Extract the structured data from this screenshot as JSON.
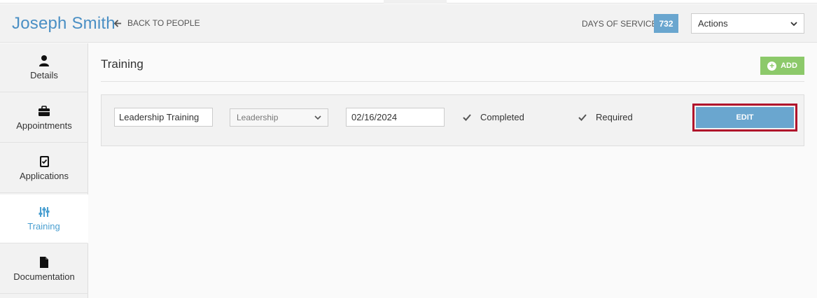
{
  "header": {
    "person_name": "Joseph Smith",
    "back_label": "BACK TO PEOPLE",
    "days_label": "DAYS OF SERVICE",
    "days_value": "732",
    "actions_label": "Actions"
  },
  "sidebar": {
    "items": [
      {
        "label": "Details",
        "icon": "user-icon"
      },
      {
        "label": "Appointments",
        "icon": "briefcase-icon"
      },
      {
        "label": "Applications",
        "icon": "clipboard-check-icon"
      },
      {
        "label": "Training",
        "icon": "sliders-icon",
        "active": true
      },
      {
        "label": "Documentation",
        "icon": "document-icon"
      }
    ]
  },
  "main": {
    "section_title": "Training",
    "add_label": "ADD",
    "training_row": {
      "name_value": "Leadership Training",
      "category_value": "Leadership",
      "date_value": "02/16/2024",
      "completed_label": "Completed",
      "completed_checked": true,
      "required_label": "Required",
      "required_checked": true,
      "edit_label": "EDIT"
    }
  },
  "colors": {
    "accent_blue": "#4a8fc4",
    "badge_blue": "#6aa6cf",
    "add_green": "#8cc96a",
    "highlight_red": "#b0112b"
  }
}
